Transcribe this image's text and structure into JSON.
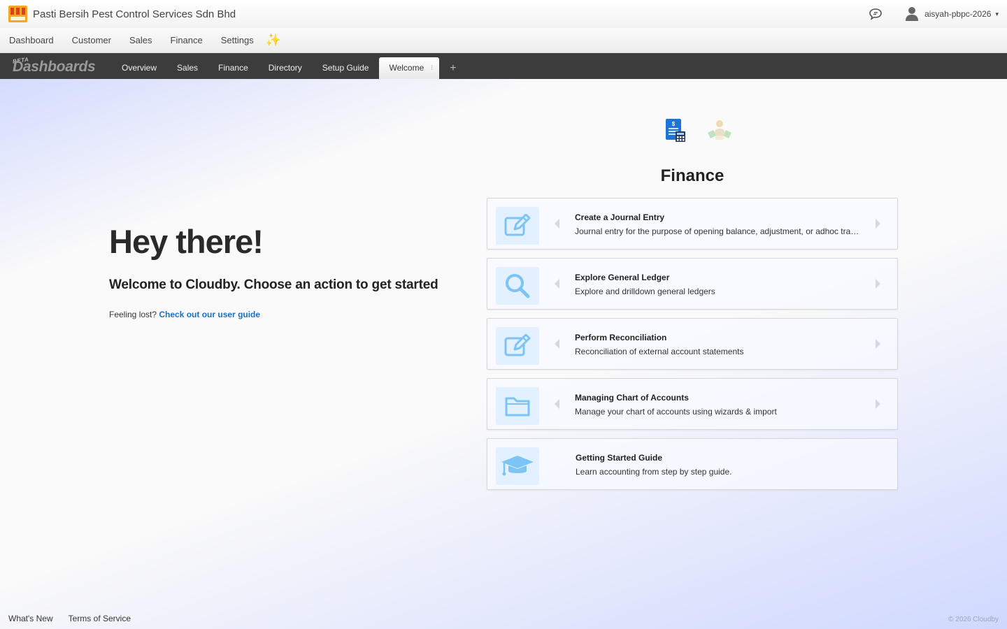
{
  "header": {
    "company": "Pasti Bersih Pest Control Services Sdn Bhd",
    "username": "aisyah-pbpc-2026",
    "caret": "▾"
  },
  "main_nav": {
    "items": [
      {
        "label": "Dashboard"
      },
      {
        "label": "Customer"
      },
      {
        "label": "Sales"
      },
      {
        "label": "Finance"
      },
      {
        "label": "Settings"
      }
    ],
    "sparkle": "✨"
  },
  "dashboard_bar": {
    "beta": "BETA",
    "title": "Dashboards",
    "tabs": [
      {
        "label": "Overview"
      },
      {
        "label": "Sales"
      },
      {
        "label": "Finance"
      },
      {
        "label": "Directory"
      },
      {
        "label": "Setup Guide"
      },
      {
        "label": "Welcome",
        "active": true
      }
    ],
    "tab_menu": "⁝",
    "add": "+"
  },
  "hero": {
    "title": "Hey there!",
    "subtitle": "Welcome to Cloudby. Choose an action to get started",
    "lost_prefix": "Feeling lost? ",
    "guide_link": "Check out our user guide"
  },
  "finance": {
    "title": "Finance",
    "section_icons": [
      "finance-calculator-icon",
      "people-icon"
    ],
    "actions": [
      {
        "title": "Create a Journal Entry",
        "desc": "Journal entry for the purpose of opening balance, adjustment, or adhoc transactions",
        "icon": "edit-icon"
      },
      {
        "title": "Explore General Ledger",
        "desc": "Explore and drilldown general ledgers",
        "icon": "search-icon"
      },
      {
        "title": "Perform Reconciliation",
        "desc": "Reconciliation of external account statements",
        "icon": "edit-icon"
      },
      {
        "title": "Managing Chart of Accounts",
        "desc": "Manage your chart of accounts using wizards & import",
        "icon": "folder-icon"
      },
      {
        "title": "Getting Started Guide",
        "desc": "Learn accounting from step by step guide.",
        "icon": "graduation-cap-icon"
      }
    ]
  },
  "footer": {
    "links": [
      {
        "label": "What's New"
      },
      {
        "label": "Terms of Service"
      }
    ],
    "copyright": "© 2026 Cloudby"
  },
  "colors": {
    "accent_link": "#1a6fc4",
    "tab_bar": "#3c3c3c",
    "icon_blue": "#7cc4f4",
    "icon_box": "#e2f0ff"
  }
}
